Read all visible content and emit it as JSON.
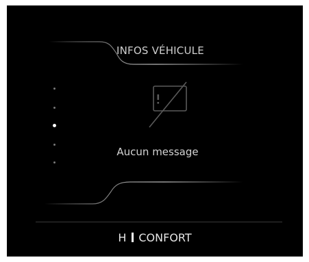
{
  "panel": {
    "title": "INFOS VÉHICULE",
    "message": "Aucun message"
  },
  "pager": {
    "total": 5,
    "active_index": 3
  },
  "status_bar": {
    "gear": "H",
    "mode": "CONFORT"
  },
  "icons": {
    "no_message": "message-crossed-icon"
  }
}
